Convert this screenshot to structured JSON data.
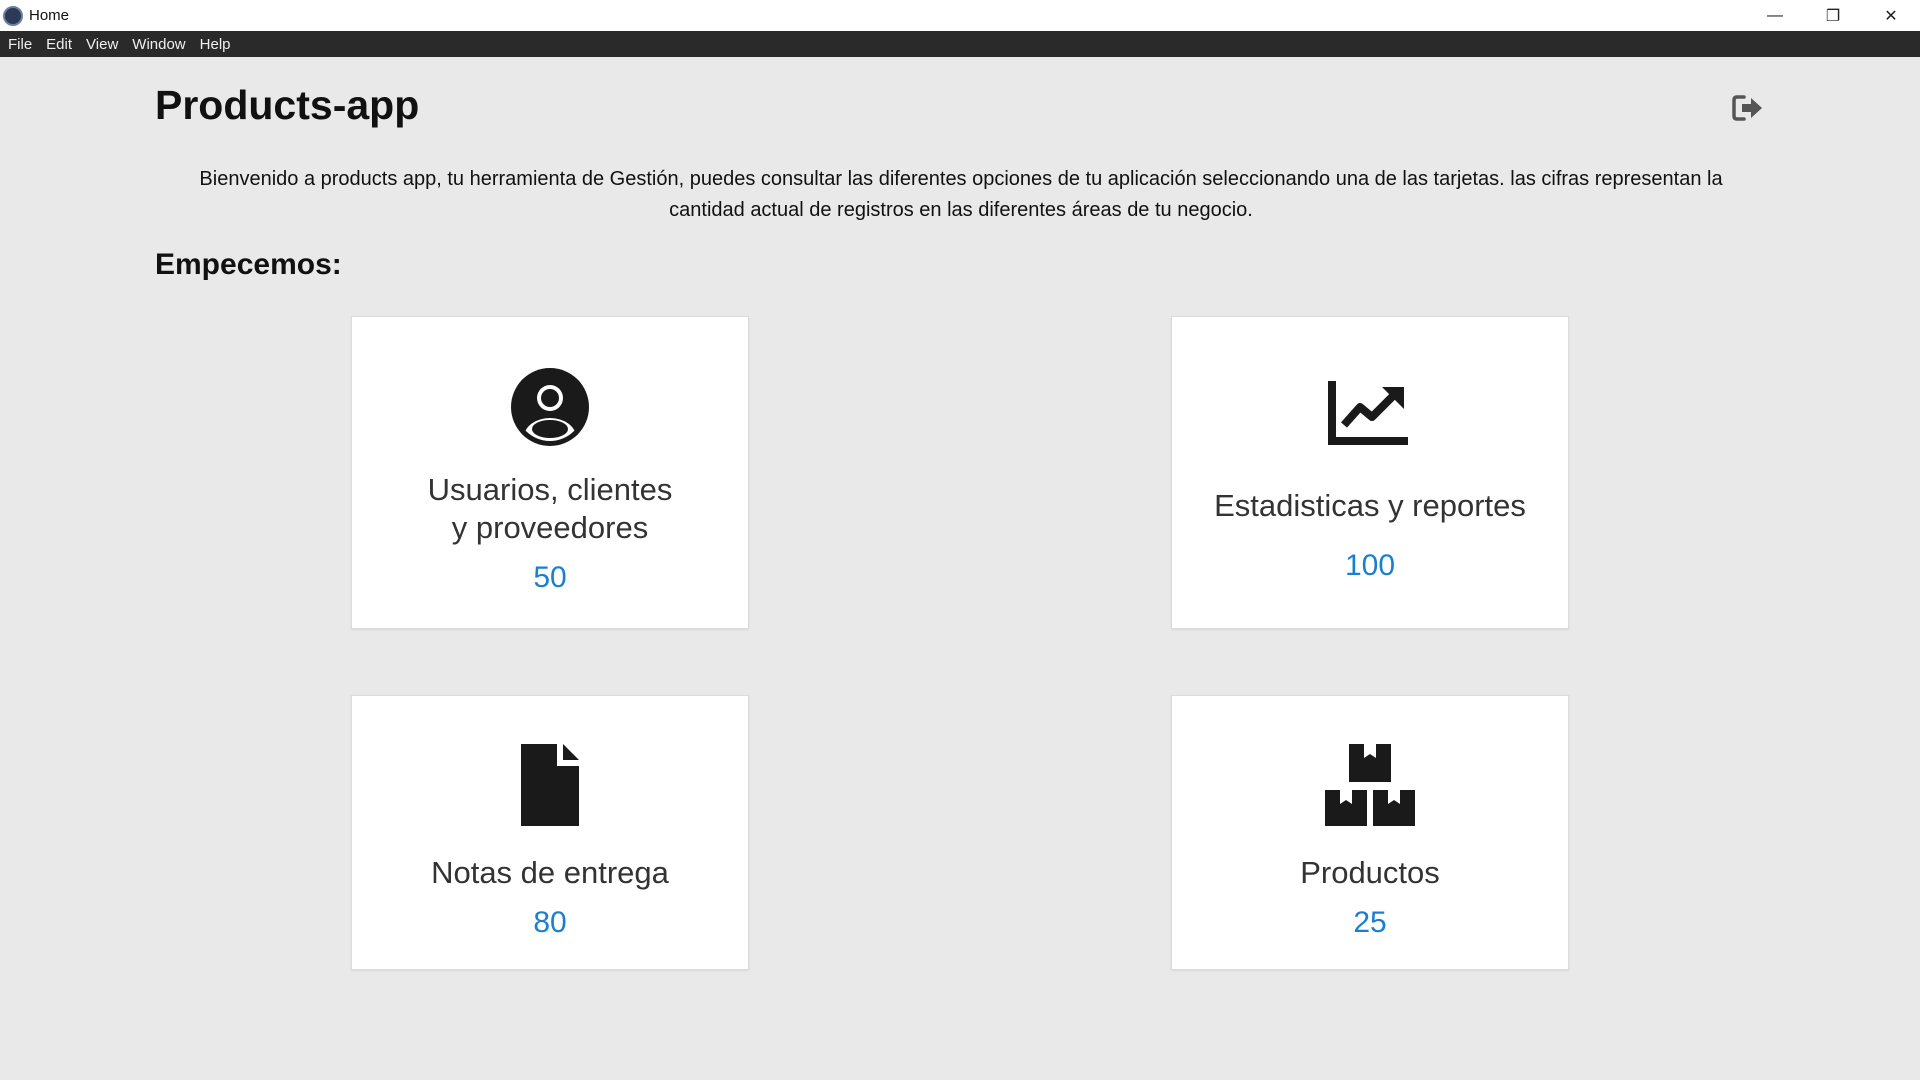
{
  "window": {
    "title": "Home",
    "controls": {
      "minimize": "—",
      "restore": "❐",
      "close": "✕"
    }
  },
  "menu": [
    "File",
    "Edit",
    "View",
    "Window",
    "Help"
  ],
  "header": {
    "title": "Products-app",
    "logout_icon": "logout-icon"
  },
  "welcome_text": "Bienvenido a products app, tu herramienta de Gestión, puedes consultar las diferentes opciones de tu aplicación seleccionando una de las tarjetas. las cifras representan la cantidad actual de registros en las diferentes áreas de tu negocio.",
  "section_title": "Empecemos:",
  "cards": [
    {
      "label": "Usuarios, clientes y proveedores",
      "count": "50",
      "icon": "user-circle-icon"
    },
    {
      "label": "Estadisticas y reportes",
      "count": "100",
      "icon": "chart-line-icon"
    },
    {
      "label": "Notas de entrega",
      "count": "80",
      "icon": "document-icon"
    },
    {
      "label": "Productos",
      "count": "25",
      "icon": "boxes-icon"
    }
  ],
  "colors": {
    "accent": "#1a7fd0",
    "background": "#e9e9e9",
    "menubar": "#2a2a2a"
  }
}
